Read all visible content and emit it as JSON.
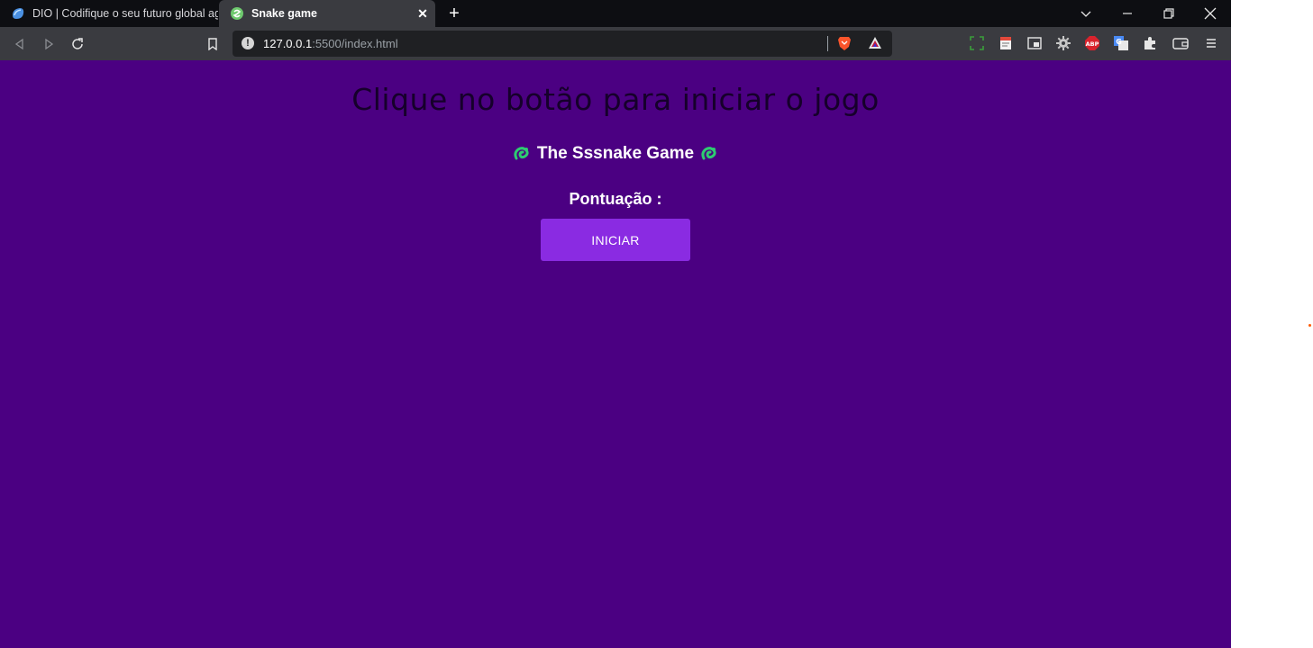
{
  "browser": {
    "tabs": [
      {
        "title": "DIO | Codifique o seu futuro global ag",
        "icon": "dio-icon",
        "active": false
      },
      {
        "title": "Snake game",
        "icon": "snake-favicon",
        "active": true
      }
    ],
    "url_host": "127.0.0.1",
    "url_path": ":5500/index.html",
    "colors": {
      "tabbar": "#0d0e12",
      "toolbar": "#3a3b40",
      "urlbar": "#1f2023"
    }
  },
  "page": {
    "heading": "Clique no botão para iniciar o jogo",
    "subtitle": "The Sssnake Game",
    "score_label": "Pontuação :",
    "start_button": "INICIAR",
    "colors": {
      "background": "#4b0082",
      "button": "#8a2be2",
      "heading": "#16002b",
      "snake": "#2ecc71",
      "dot": "#ff5a00"
    }
  }
}
